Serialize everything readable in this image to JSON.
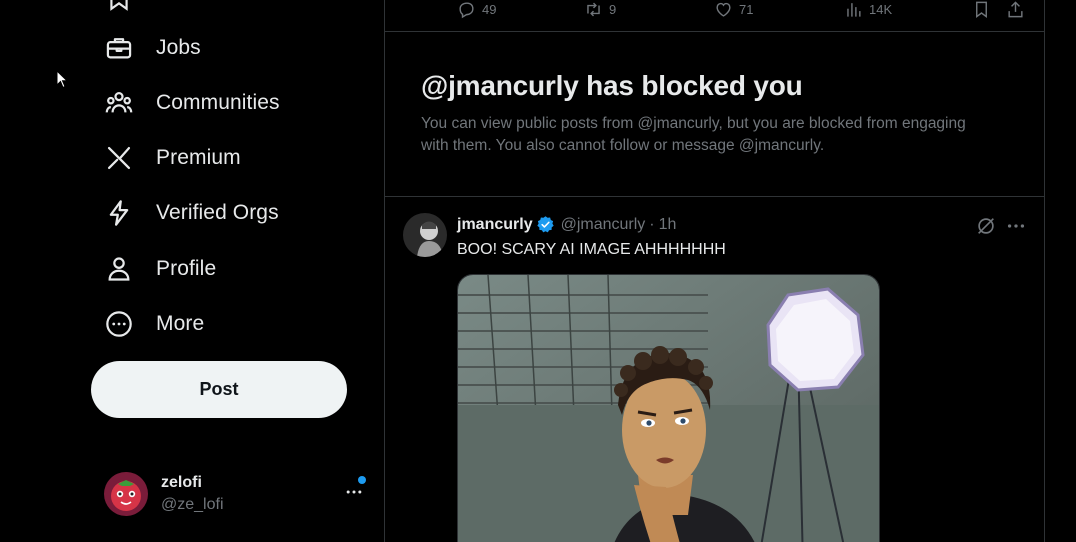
{
  "sidebar": {
    "items": [
      {
        "label": "Jobs",
        "icon": "briefcase-icon"
      },
      {
        "label": "Communities",
        "icon": "people-icon"
      },
      {
        "label": "Premium",
        "icon": "x-logo-icon"
      },
      {
        "label": "Verified Orgs",
        "icon": "lightning-icon"
      },
      {
        "label": "Profile",
        "icon": "person-icon"
      },
      {
        "label": "More",
        "icon": "more-circle-icon"
      }
    ],
    "post_label": "Post"
  },
  "account": {
    "name": "zelofi",
    "handle": "@ze_lofi"
  },
  "prev_tweet_actions": {
    "replies": "49",
    "reposts": "9",
    "likes": "71",
    "views": "14K"
  },
  "blocked": {
    "title": "@jmancurly has blocked you",
    "description": "You can view public posts from @jmancurly, but you are blocked from engaging with them. You also cannot follow or message @jmancurly."
  },
  "tweet": {
    "name": "jmancurly",
    "handle": "@jmancurly",
    "separator": "·",
    "time": "1h",
    "text": "BOO! SCARY AI IMAGE AHHHHHHH"
  },
  "colors": {
    "background": "#000000",
    "text": "#e7e9ea",
    "muted": "#71767b",
    "border": "#2f3336",
    "accent": "#1d9bf0",
    "post_button": "#eff3f4"
  }
}
